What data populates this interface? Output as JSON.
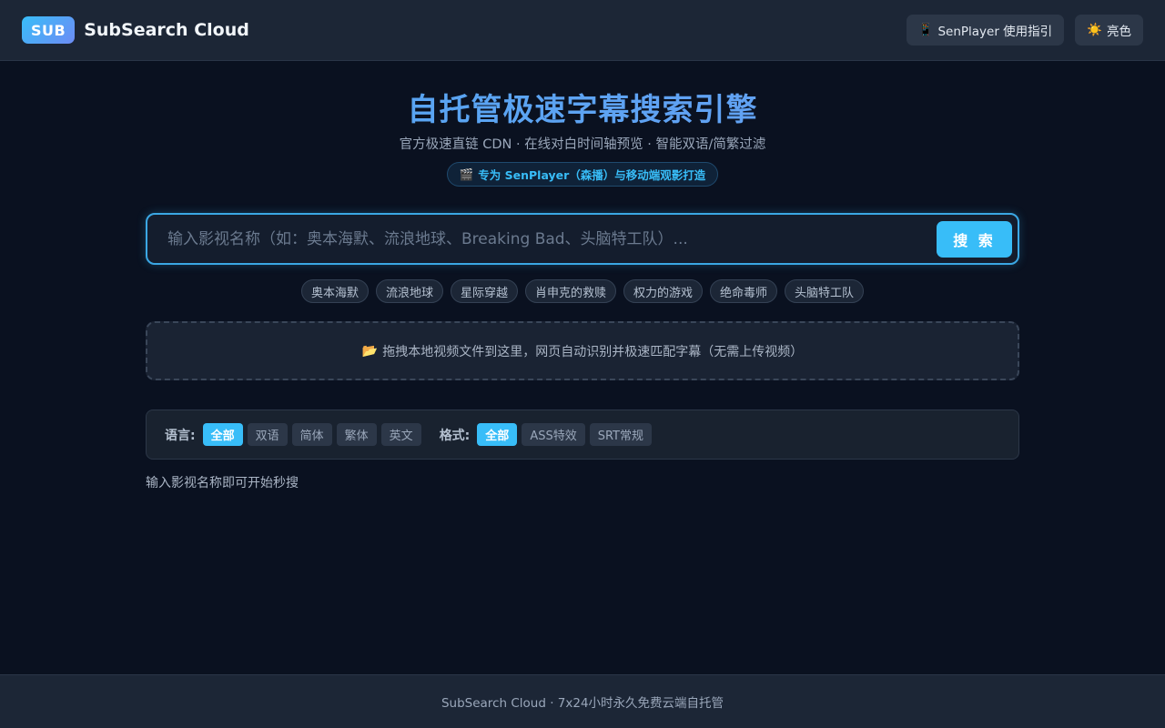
{
  "header": {
    "logo_text": "SUB",
    "app_name": "SubSearch Cloud",
    "guide_button": {
      "icon": "📱",
      "label": "SenPlayer 使用指引"
    },
    "theme_button": {
      "icon": "☀️",
      "label": "亮色"
    }
  },
  "hero": {
    "title": "自托管极速字幕搜索引擎",
    "subtitle": "官方极速直链 CDN · 在线对白时间轴预览 · 智能双语/简繁过滤",
    "tag": {
      "icon": "🎬",
      "text": "专为 SenPlayer（森播）与移动端观影打造"
    }
  },
  "search": {
    "placeholder": "输入影视名称（如：奥本海默、流浪地球、Breaking Bad、头脑特工队）...",
    "value": "",
    "button_label": "搜 索"
  },
  "hot_tags": [
    "奥本海默",
    "流浪地球",
    "星际穿越",
    "肖申克的救赎",
    "权力的游戏",
    "绝命毒师",
    "头脑特工队"
  ],
  "dropzone": {
    "icon": "📂",
    "text": "拖拽本地视频文件到这里，网页自动识别并极速匹配字幕（无需上传视频）"
  },
  "filters": {
    "language": {
      "label": "语言:",
      "options": [
        "全部",
        "双语",
        "简体",
        "繁体",
        "英文"
      ],
      "selected": "全部"
    },
    "format": {
      "label": "格式:",
      "options": [
        "全部",
        "ASS特效",
        "SRT常规"
      ],
      "selected": "全部"
    }
  },
  "status_text": "输入影视名称即可开始秒搜",
  "footer_text": "SubSearch Cloud · 7x24小时永久免费云端自托管",
  "colors": {
    "accent": "#38bdf8",
    "background": "#0a1120",
    "panel": "#1c2636"
  }
}
